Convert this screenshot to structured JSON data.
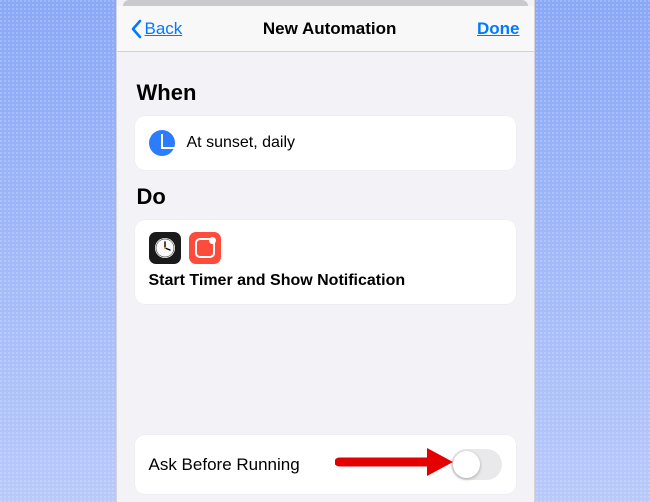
{
  "nav": {
    "back_label": "Back",
    "title": "New Automation",
    "done_label": "Done"
  },
  "sections": {
    "when_header": "When",
    "do_header": "Do"
  },
  "when": {
    "text": "At sunset, daily"
  },
  "do": {
    "summary": "Start Timer and Show Notification"
  },
  "settings": {
    "ask_before_running_label": "Ask Before Running",
    "ask_before_running_on": false
  },
  "colors": {
    "accent": "#007aff",
    "when_icon_bg": "#2b7cff",
    "notif_icon_bg": "#fd4b3c"
  }
}
